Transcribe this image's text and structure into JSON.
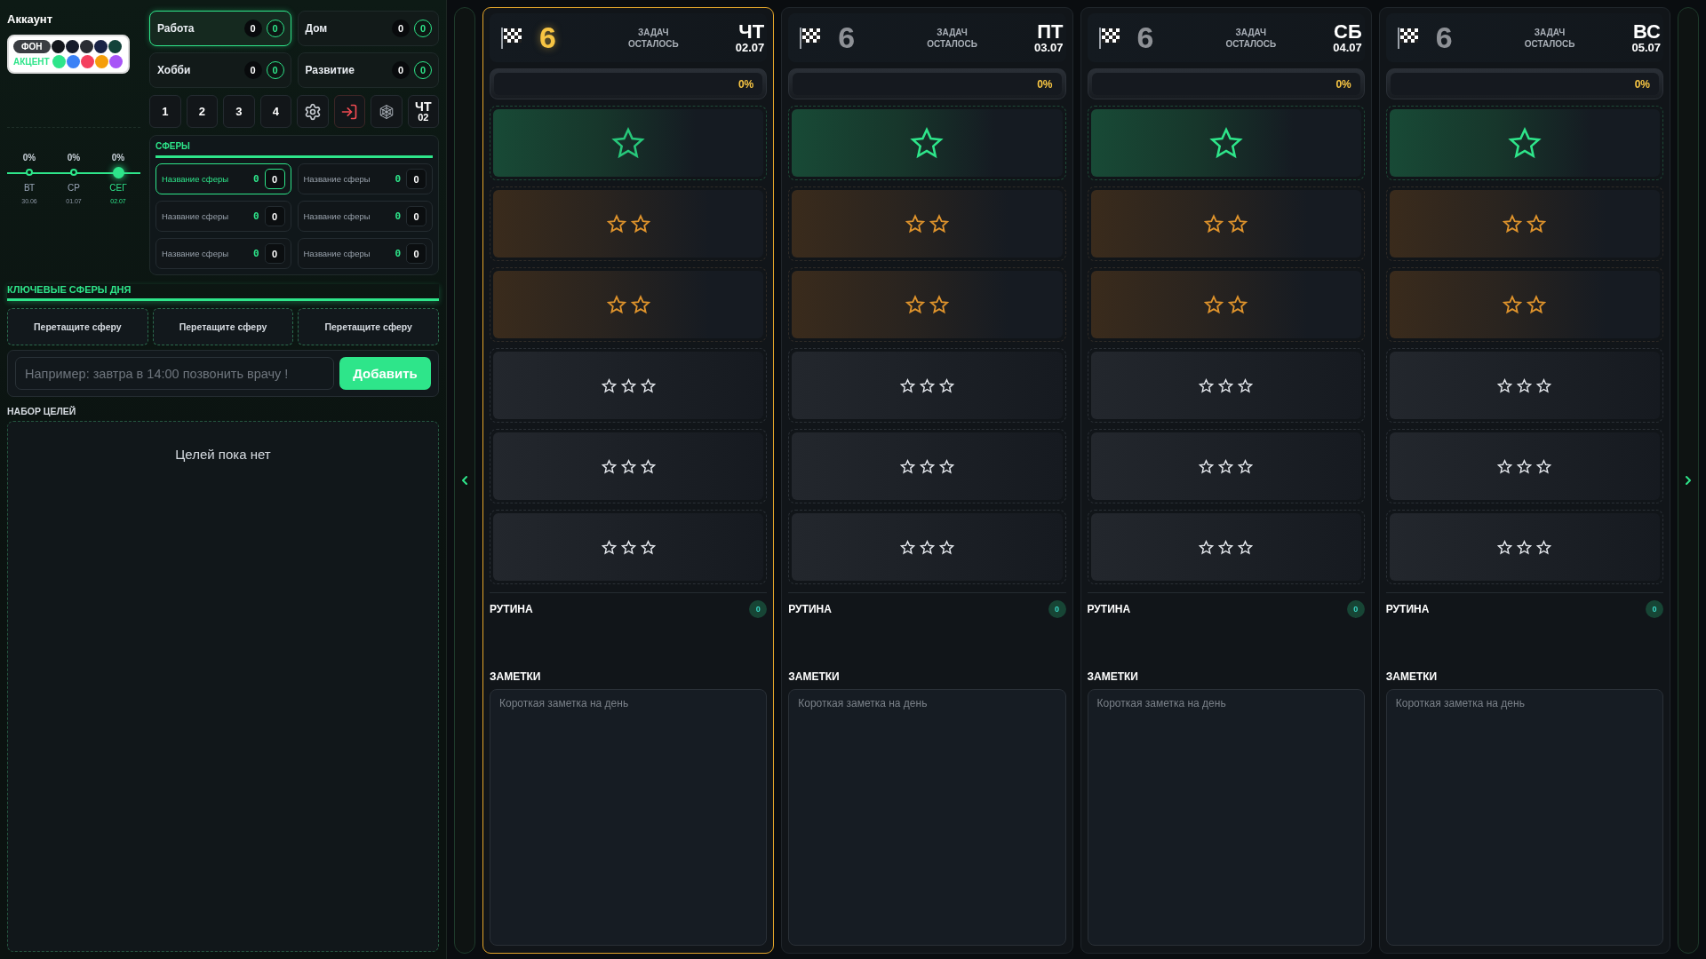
{
  "account": {
    "title": "Аккаунт",
    "palette": {
      "bg_label": "ФОН",
      "accent_label": "АКЦЕНТ",
      "bg_colors": [
        {
          "color": "#14171c"
        },
        {
          "color": "#171c2b"
        },
        {
          "color": "#2a2d33"
        },
        {
          "color": "#1a2446"
        },
        {
          "color": "#12423a"
        }
      ],
      "accent_colors": [
        {
          "color": "#2ee58a"
        },
        {
          "color": "#3b82f6"
        },
        {
          "color": "#f43f5e"
        },
        {
          "color": "#f59e0b"
        },
        {
          "color": "#a855f7"
        }
      ]
    }
  },
  "categories": [
    {
      "name": "Работа",
      "count": "0",
      "done": "0",
      "selected": true
    },
    {
      "name": "Дом",
      "count": "0",
      "done": "0",
      "selected": false
    },
    {
      "name": "Хобби",
      "count": "0",
      "done": "0",
      "selected": false
    },
    {
      "name": "Развитие",
      "count": "0",
      "done": "0",
      "selected": false
    }
  ],
  "toolbar": [
    {
      "kind": "number",
      "label": "1"
    },
    {
      "kind": "number",
      "label": "2"
    },
    {
      "kind": "number",
      "label": "3"
    },
    {
      "kind": "number",
      "label": "4"
    },
    {
      "kind": "settings"
    },
    {
      "kind": "logout"
    },
    {
      "kind": "web"
    },
    {
      "kind": "day",
      "label": "ЧТ",
      "sublabel": "02"
    }
  ],
  "timeline": [
    {
      "percent": "0%",
      "day": "ВТ",
      "date": "30.06",
      "selected": false
    },
    {
      "percent": "0%",
      "day": "СР",
      "date": "01.07",
      "selected": false
    },
    {
      "percent": "0%",
      "day": "СЕГ",
      "date": "02.07",
      "selected": true
    }
  ],
  "spheres": {
    "title": "СФЕРЫ",
    "items": [
      {
        "name": "Название сферы",
        "score": "0",
        "count": "0",
        "selected": true
      },
      {
        "name": "Название сферы",
        "score": "0",
        "count": "0",
        "selected": false
      },
      {
        "name": "Название сферы",
        "score": "0",
        "count": "0",
        "selected": false
      },
      {
        "name": "Название сферы",
        "score": "0",
        "count": "0",
        "selected": false
      },
      {
        "name": "Название сферы",
        "score": "0",
        "count": "0",
        "selected": false
      },
      {
        "name": "Название сферы",
        "score": "0",
        "count": "0",
        "selected": false
      }
    ]
  },
  "key_spheres": {
    "title": "КЛЮЧЕВЫЕ СФЕРЫ ДНЯ",
    "slots": [
      "Перетащите сферу",
      "Перетащите сферу",
      "Перетащите сферу"
    ]
  },
  "task_input": {
    "placeholder": "Например: завтра в 14:00 позвонить врачу !",
    "button": "Добавить"
  },
  "goals": {
    "title": "НАБОР ЦЕЛЕЙ",
    "empty_text": "Целей пока нет"
  },
  "days": [
    {
      "day": "ЧТ",
      "date": "02.07",
      "remaining": "6",
      "remaining_label": "ЗАДАЧ ОСТАЛОСЬ",
      "selected": true,
      "progress_label": "0%",
      "level": 0,
      "slots": [
        {
          "kind": "single"
        },
        {
          "kind": "double"
        },
        {
          "kind": "double"
        },
        {
          "kind": "triple"
        },
        {
          "kind": "triple"
        },
        {
          "kind": "triple"
        }
      ],
      "routine": {
        "title": "РУТИНА",
        "count": "0"
      },
      "notes": {
        "title": "ЗАМЕТКИ",
        "placeholder": "Короткая заметка на день"
      }
    },
    {
      "day": "ПТ",
      "date": "03.07",
      "remaining": "6",
      "remaining_label": "ЗАДАЧ ОСТАЛОСЬ",
      "selected": false,
      "progress_label": "0%",
      "level": 0,
      "slots": [
        {
          "kind": "single"
        },
        {
          "kind": "double"
        },
        {
          "kind": "double"
        },
        {
          "kind": "triple"
        },
        {
          "kind": "triple"
        },
        {
          "kind": "triple"
        }
      ],
      "routine": {
        "title": "РУТИНА",
        "count": "0"
      },
      "notes": {
        "title": "ЗАМЕТКИ",
        "placeholder": "Короткая заметка на день"
      }
    },
    {
      "day": "СБ",
      "date": "04.07",
      "remaining": "6",
      "remaining_label": "ЗАДАЧ ОСТАЛОСЬ",
      "selected": false,
      "progress_label": "0%",
      "level": 0,
      "slots": [
        {
          "kind": "single"
        },
        {
          "kind": "double"
        },
        {
          "kind": "double"
        },
        {
          "kind": "triple"
        },
        {
          "kind": "triple"
        },
        {
          "kind": "triple"
        }
      ],
      "routine": {
        "title": "РУТИНА",
        "count": "0"
      },
      "notes": {
        "title": "ЗАМЕТКИ",
        "placeholder": "Короткая заметка на день"
      }
    },
    {
      "day": "ВС",
      "date": "05.07",
      "remaining": "6",
      "remaining_label": "ЗАДАЧ ОСТАЛОСЬ",
      "selected": false,
      "progress_label": "0%",
      "level": 0,
      "slots": [
        {
          "kind": "single"
        },
        {
          "kind": "double"
        },
        {
          "kind": "double"
        },
        {
          "kind": "triple"
        },
        {
          "kind": "triple"
        },
        {
          "kind": "triple"
        }
      ],
      "routine": {
        "title": "РУТИНА",
        "count": "0"
      },
      "notes": {
        "title": "ЗАМЕТКИ",
        "placeholder": "Короткая заметка на день"
      }
    }
  ]
}
